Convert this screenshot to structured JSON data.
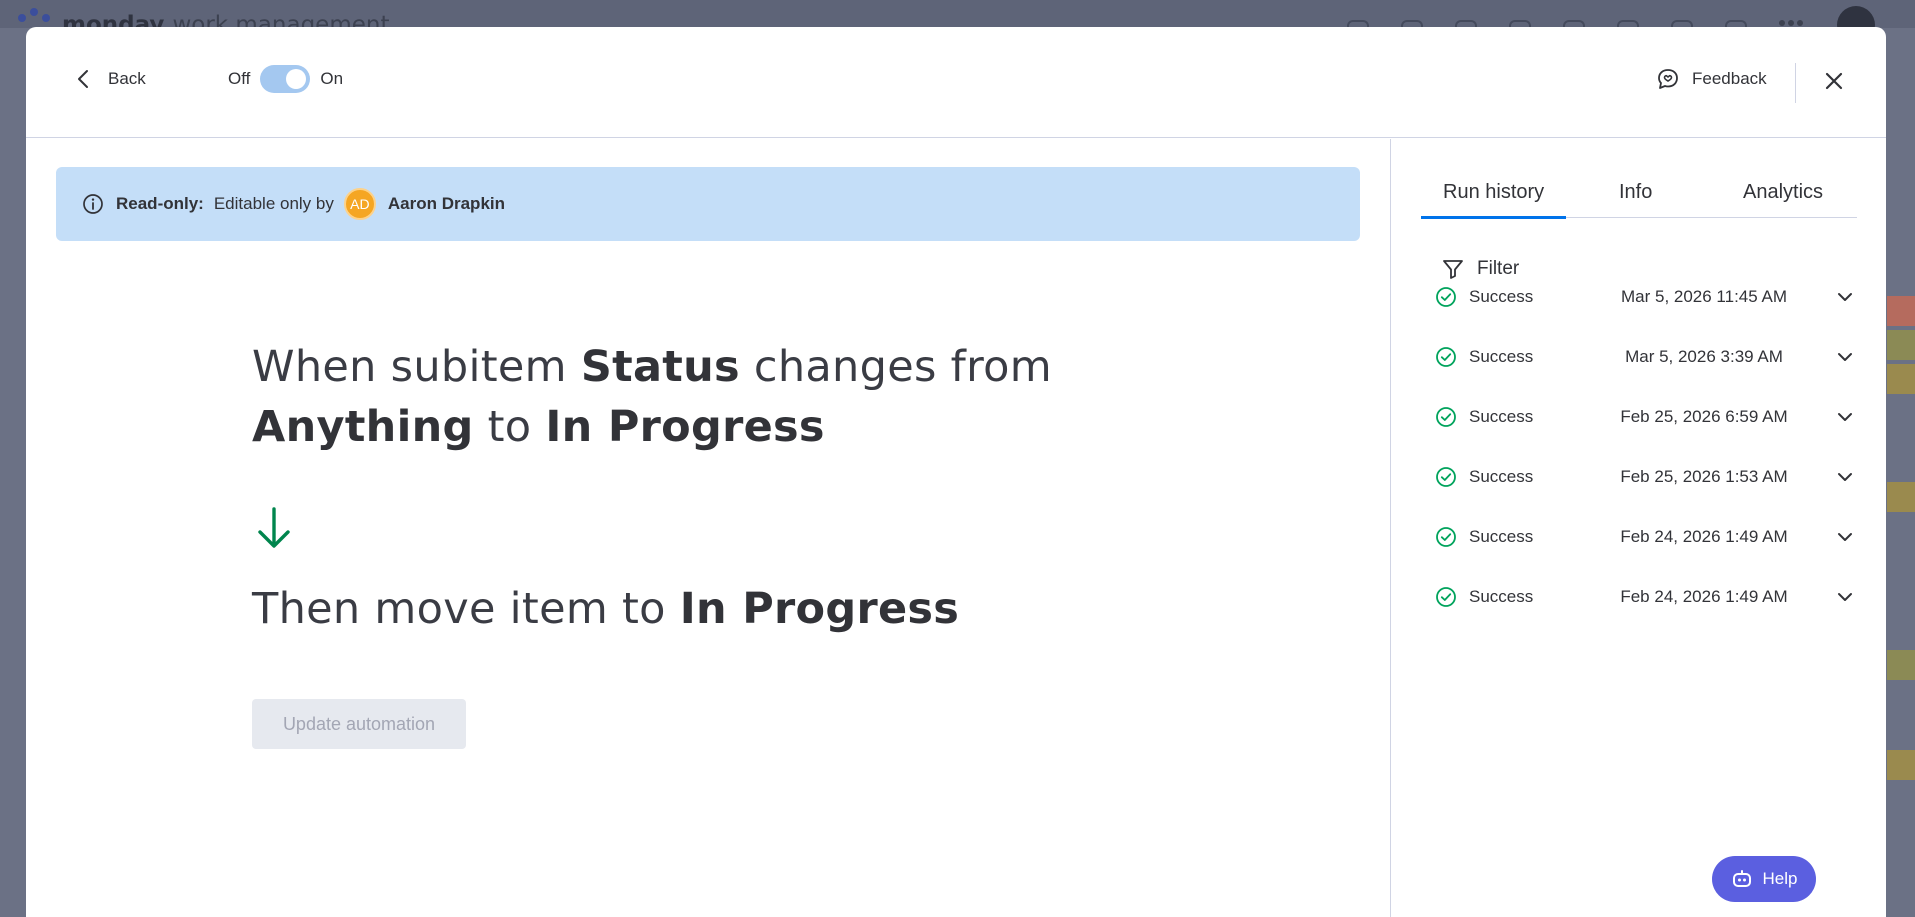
{
  "background_app": {
    "brand_name": "monday",
    "brand_suffix": "work management"
  },
  "header": {
    "back_label": "Back",
    "toggle_off_label": "Off",
    "toggle_on_label": "On",
    "toggle_state": "on",
    "feedback_label": "Feedback"
  },
  "banner": {
    "label": "Read-only:",
    "text": "Editable only by",
    "avatar_initials": "AD",
    "user_name": "Aaron Drapkin"
  },
  "automation": {
    "trigger": {
      "part1": "When subitem",
      "column": "Status",
      "part2": "changes from",
      "from_value": "Anything",
      "part3": "to",
      "to_value": "In Progress"
    },
    "action": {
      "part1": "Then move item to",
      "target": "In Progress"
    },
    "update_button": "Update automation"
  },
  "tabs": {
    "run_history": "Run history",
    "info": "Info",
    "analytics": "Analytics",
    "active": "run_history"
  },
  "filter_label": "Filter",
  "runs": [
    {
      "status": "Success",
      "date": "Mar 5, 2026 11:45 AM"
    },
    {
      "status": "Success",
      "date": "Mar 5, 2026 3:39 AM"
    },
    {
      "status": "Success",
      "date": "Feb 25, 2026 6:59 AM"
    },
    {
      "status": "Success",
      "date": "Feb 25, 2026 1:53 AM"
    },
    {
      "status": "Success",
      "date": "Feb 24, 2026 1:49 AM"
    },
    {
      "status": "Success",
      "date": "Feb 24, 2026 1:49 AM"
    }
  ],
  "help_label": "Help",
  "colors": {
    "accent": "#0073ea",
    "success": "#00a35c",
    "banner_bg": "#c4def8",
    "help_bg": "#5b5fe0",
    "arrow": "#00854d"
  }
}
